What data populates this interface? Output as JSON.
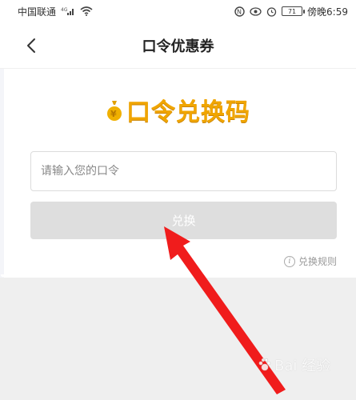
{
  "status_bar": {
    "carrier": "中国联通",
    "network": "4G",
    "battery": "71",
    "time": "傍晚6:59"
  },
  "nav": {
    "title": "口令优惠券"
  },
  "main": {
    "headline": "口令兑换码",
    "input_placeholder": "请输入您的口令",
    "input_value": "",
    "redeem_label": "兑换",
    "rules_label": "兑换规则"
  },
  "watermark": {
    "text": "Bai 经验"
  },
  "colors": {
    "headline": "#f0a500",
    "button_disabled": "#dedede",
    "annotation_arrow": "#f01c1c",
    "background_gray": "#efefef"
  }
}
